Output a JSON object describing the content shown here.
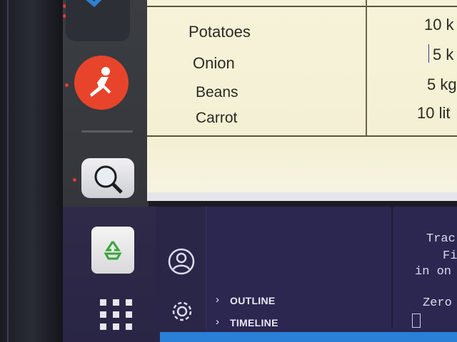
{
  "dock": {
    "apps": [
      {
        "name": "vscode",
        "icon": "vscode-icon"
      },
      {
        "name": "postman",
        "icon": "postman-icon"
      },
      {
        "name": "search",
        "icon": "magnifier-icon"
      },
      {
        "name": "trash",
        "icon": "recycle-icon"
      },
      {
        "name": "app-grid",
        "icon": "grid-icon"
      }
    ]
  },
  "sheet": {
    "rows": [
      {
        "item": "Potatoes",
        "qty": "10 k"
      },
      {
        "item": "Onion",
        "qty": "5 k"
      },
      {
        "item": "Beans",
        "qty": "5 kg"
      },
      {
        "item": "Carrot",
        "qty": "10 lit"
      }
    ]
  },
  "sidebar": {
    "sections": [
      {
        "label": "OUTLINE"
      },
      {
        "label": "TIMELINE"
      }
    ]
  },
  "terminal": {
    "lines": [
      "Trac",
      "Fi",
      "in on",
      "Zero"
    ]
  },
  "colors": {
    "sheet_bg": "#f6f3d9",
    "panel_bg": "#2b2750",
    "postman": "#e8442c",
    "statusbar": "#2a7fd6"
  }
}
